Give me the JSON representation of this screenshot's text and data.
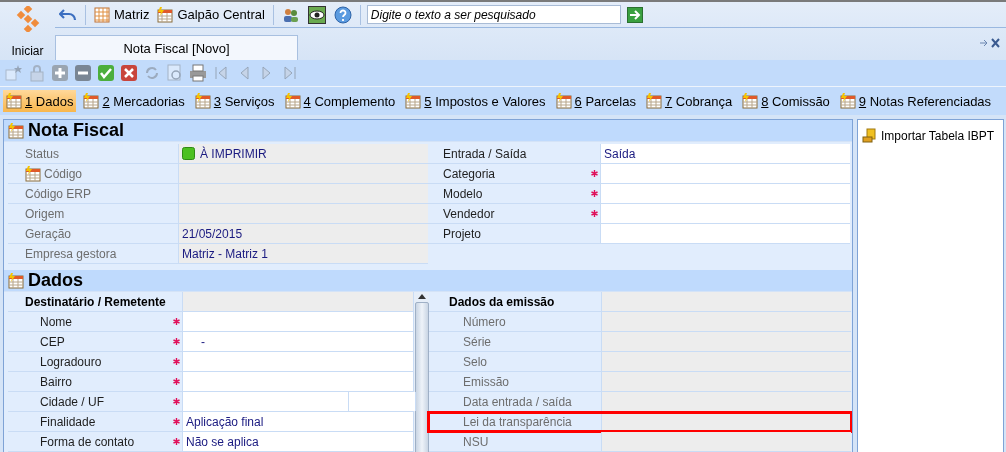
{
  "launcher": {
    "label": "Iniciar"
  },
  "quick_toolbar": {
    "companies": [
      {
        "label": "Matriz",
        "kind": "company"
      },
      {
        "label": "Galpão Central",
        "kind": "branch"
      }
    ]
  },
  "search": {
    "placeholder": "Digite o texto a ser pesquisado"
  },
  "document_tabs": [
    {
      "label": "Nota Fiscal [Novo]",
      "selected": true
    }
  ],
  "tools": [
    {
      "kind": "new",
      "disabled": true
    },
    {
      "kind": "lock",
      "disabled": true
    },
    {
      "kind": "add",
      "disabled": false
    },
    {
      "kind": "remove",
      "disabled": false
    },
    {
      "kind": "confirm",
      "disabled": false
    },
    {
      "kind": "cancel",
      "disabled": false
    },
    {
      "kind": "refresh",
      "disabled": true
    },
    {
      "kind": "preview",
      "disabled": true
    },
    {
      "kind": "print",
      "disabled": false
    },
    {
      "kind": "first",
      "disabled": true
    },
    {
      "kind": "prev",
      "disabled": true
    },
    {
      "kind": "next",
      "disabled": true
    },
    {
      "kind": "last",
      "disabled": true
    }
  ],
  "section_tabs": [
    {
      "key": "1",
      "label": "Dados",
      "selected": true
    },
    {
      "key": "2",
      "label": "Mercadorias",
      "selected": false
    },
    {
      "key": "3",
      "label": "Serviços",
      "selected": false
    },
    {
      "key": "4",
      "label": "Complemento",
      "selected": false
    },
    {
      "key": "5",
      "label": "Impostos e Valores",
      "selected": false
    },
    {
      "key": "6",
      "label": "Parcelas",
      "selected": false
    },
    {
      "key": "7",
      "label": "Cobrança",
      "selected": false
    },
    {
      "key": "8",
      "label": "Comissão",
      "selected": false
    },
    {
      "key": "9",
      "label": "Notas Referenciadas",
      "selected": false
    }
  ],
  "nota_fiscal": {
    "title": "Nota Fiscal",
    "left_fields": [
      {
        "label": "Status",
        "value": "À IMPRIMIR",
        "kind": "status",
        "readonly": true,
        "required": false
      },
      {
        "label": "Código",
        "kind": "code",
        "readonly": true,
        "required": false
      },
      {
        "label": "Código ERP",
        "kind": "plain",
        "readonly": true,
        "required": false
      },
      {
        "label": "Origem",
        "kind": "plain",
        "readonly": true,
        "required": false
      },
      {
        "label": "Geração",
        "value": "21/05/2015",
        "kind": "plain",
        "readonly": true,
        "required": false
      },
      {
        "label": "Empresa gestora",
        "value": "Matriz - Matriz 1",
        "kind": "plain",
        "readonly": true,
        "required": false
      }
    ],
    "right_fields": [
      {
        "label": "Entrada / Saída",
        "value": "Saída",
        "kind": "plain",
        "readonly": false,
        "required": false
      },
      {
        "label": "Categoria",
        "kind": "plain",
        "readonly": false,
        "required": true
      },
      {
        "label": "Modelo",
        "kind": "plain",
        "readonly": false,
        "required": true
      },
      {
        "label": "Vendedor",
        "kind": "plain",
        "readonly": false,
        "required": true
      },
      {
        "label": "Projeto",
        "kind": "plain",
        "readonly": false,
        "required": false
      }
    ]
  },
  "dados": {
    "title": "Dados",
    "left_group": {
      "title": "Destinatário / Remetente",
      "fields": [
        {
          "label": "Nome",
          "kind": "plain",
          "readonly": false,
          "required": true
        },
        {
          "label": "CEP",
          "value": "-",
          "kind": "masked",
          "readonly": false,
          "required": true
        },
        {
          "label": "Logradouro",
          "kind": "plain",
          "readonly": false,
          "required": true
        },
        {
          "label": "Bairro",
          "kind": "plain",
          "readonly": false,
          "required": true
        },
        {
          "label": "Cidade / UF",
          "kind": "split",
          "readonly": false,
          "required": true
        },
        {
          "label": "Finalidade",
          "value": "Aplicação final",
          "kind": "plain",
          "readonly": false,
          "required": true
        },
        {
          "label": "Forma de contato",
          "value": "Não se aplica",
          "kind": "plain",
          "readonly": false,
          "required": true
        }
      ]
    },
    "right_group": {
      "title": "Dados da emissão",
      "fields": [
        {
          "label": "Número",
          "kind": "plain",
          "readonly": true,
          "required": false,
          "highlighted": false
        },
        {
          "label": "Série",
          "kind": "plain",
          "readonly": true,
          "required": false,
          "highlighted": false
        },
        {
          "label": "Selo",
          "kind": "plain",
          "readonly": true,
          "required": false,
          "highlighted": false
        },
        {
          "label": "Emissão",
          "kind": "plain",
          "readonly": true,
          "required": false,
          "highlighted": false
        },
        {
          "label": "Data entrada / saída",
          "kind": "plain",
          "readonly": true,
          "required": false,
          "highlighted": false
        },
        {
          "label": "Lei da transparência",
          "kind": "plain",
          "readonly": true,
          "required": false,
          "highlighted": true
        },
        {
          "label": "NSU",
          "kind": "plain",
          "readonly": true,
          "required": false,
          "highlighted": false
        }
      ]
    }
  },
  "side_panel": {
    "actions": [
      {
        "label": "Importar Tabela IBPT"
      }
    ]
  }
}
